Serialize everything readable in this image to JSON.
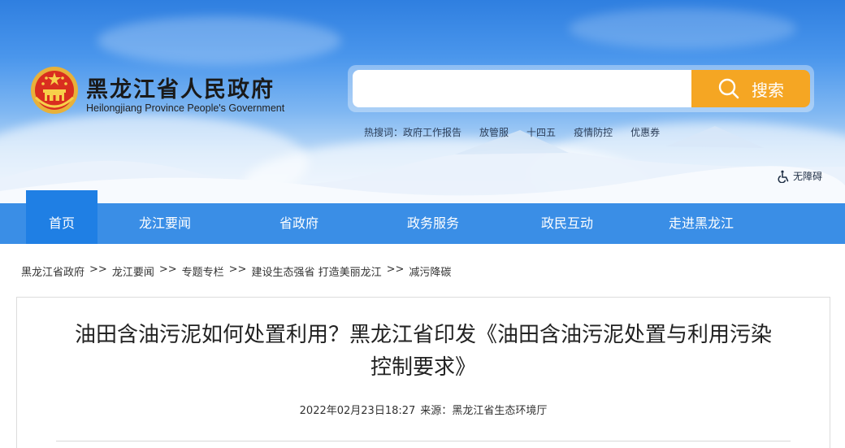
{
  "header": {
    "site_title": "黑龙江省人民政府",
    "site_subtitle": "Heilongjiang Province People's Government",
    "emblem_icon": "national-emblem-icon"
  },
  "search": {
    "placeholder": "",
    "button_label": "搜索",
    "button_color": "#f5a623",
    "icon": "search-icon"
  },
  "hot_search": {
    "label": "热搜词：",
    "items": [
      "政府工作报告",
      "放管服",
      "十四五",
      "疫情防控",
      "优惠券"
    ]
  },
  "accessibility": {
    "label": "无障碍",
    "icon": "wheelchair-icon"
  },
  "nav": {
    "color": "#3a8ee6",
    "active_color": "#1f7fe4",
    "items": [
      "首页",
      "龙江要闻",
      "省政府",
      "政务服务",
      "政民互动",
      "走进黑龙江"
    ]
  },
  "breadcrumb": {
    "separator": ">>",
    "items": [
      "黑龙江省政府",
      "龙江要闻",
      "专题专栏",
      "建设生态强省 打造美丽龙江",
      "减污降碳"
    ]
  },
  "article": {
    "title": "油田含油污泥如何处置利用？黑龙江省印发《油田含油污泥处置与利用污染控制要求》",
    "date": "2022年02月23日18:27",
    "source_label": "来源：",
    "source": "黑龙江省生态环境厅"
  }
}
